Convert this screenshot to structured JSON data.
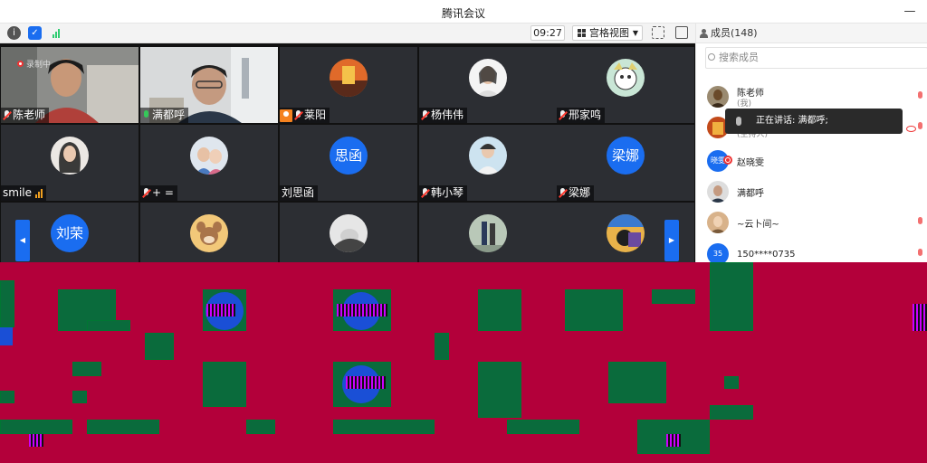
{
  "window": {
    "title": "腾讯会议"
  },
  "toolbar": {
    "clock": "09:27",
    "view_label": "宫格视图"
  },
  "tiles": [
    {
      "name": "陈老师",
      "status": "录制中"
    },
    {
      "name": "满都呼"
    },
    {
      "name": "莱阳"
    },
    {
      "name": "杨伟伟"
    },
    {
      "name": "邢家鸣"
    },
    {
      "name": "smile"
    },
    {
      "name": "+ ="
    },
    {
      "name": "刘思函",
      "avatar_text": "思函"
    },
    {
      "name": "韩小琴"
    },
    {
      "name": "梁娜",
      "avatar_text": "梁娜"
    },
    {
      "avatar_text": "刘荣"
    }
  ],
  "panel": {
    "title": "成员(148)",
    "search_placeholder": "搜索成员",
    "members": [
      {
        "name": "陈老师",
        "role": "(我)"
      },
      {
        "name": "",
        "role": "(主持人)"
      },
      {
        "name": "赵晓雯",
        "avatar_text": "晓雯"
      },
      {
        "name": "满都呼"
      },
      {
        "name": "~云卜间~"
      },
      {
        "name": "150****0735",
        "avatar_text": "35"
      }
    ],
    "speaking_tip": "正在讲话: 满都呼;"
  },
  "colors": {
    "accent_blue": "#1a6df0",
    "glitch_red": "#b3003a",
    "glitch_green": "#0a6b3c",
    "active_green": "#2ecc71"
  }
}
